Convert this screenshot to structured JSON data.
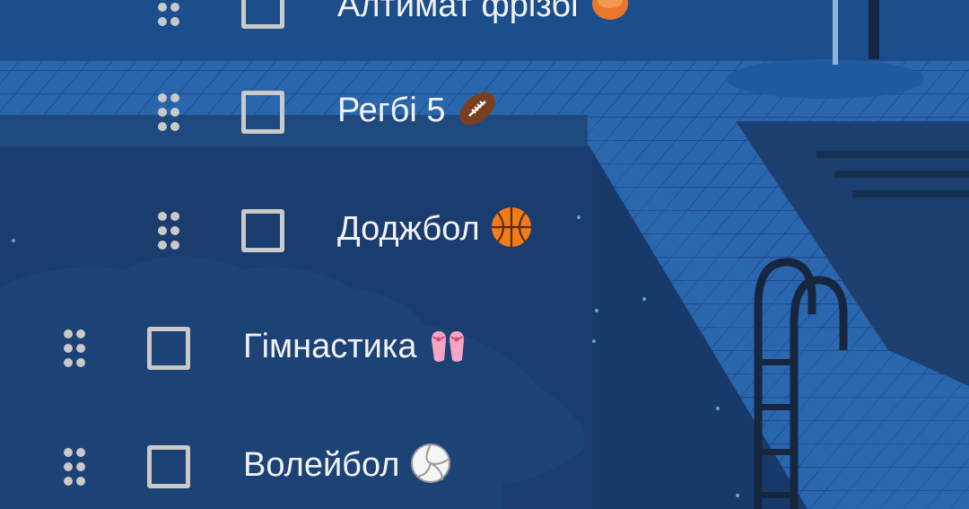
{
  "items": [
    {
      "label": "Алтимат фрізбі",
      "emoji": "flying-disc-icon"
    },
    {
      "label": "Регбі 5",
      "emoji": "rugby-football-icon"
    },
    {
      "label": "Доджбол",
      "emoji": "basketball-icon"
    },
    {
      "label": "Гімнастика",
      "emoji": "ballet-shoes-icon"
    },
    {
      "label": "Волейбол",
      "emoji": "volleyball-icon"
    }
  ],
  "colors": {
    "background": "#173a6b",
    "checkbox_border": "#c9c9c9",
    "handle_dots": "#c9c9c9",
    "text": "#f2f2f2",
    "pool_tile": "#2e6db5"
  }
}
